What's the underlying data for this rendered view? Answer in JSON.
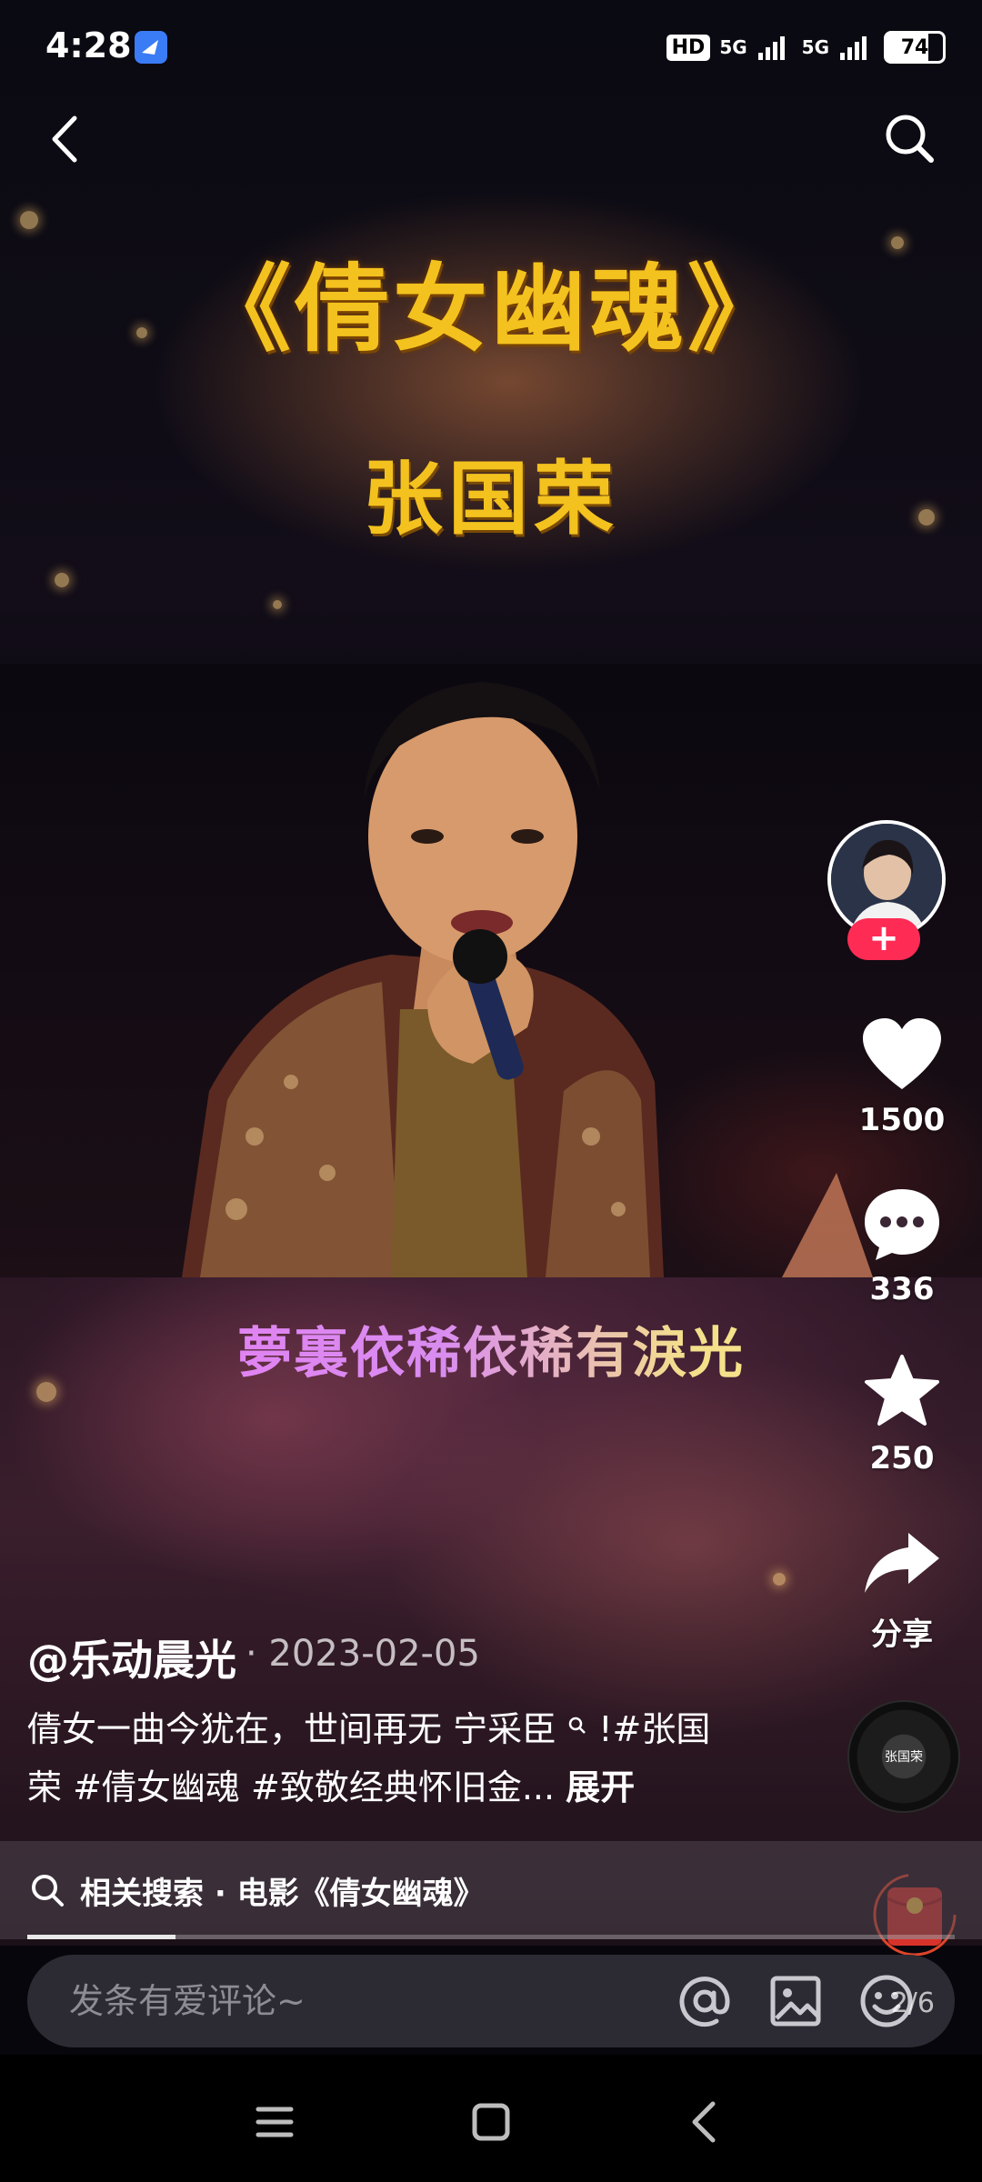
{
  "status_bar": {
    "time": "4:28",
    "network_labels": [
      "HD",
      "5G",
      "5G"
    ],
    "battery": "74"
  },
  "video": {
    "title": "《倩女幽魂》",
    "singer": "张国荣",
    "lyric": "夢裏依稀依稀有淚光"
  },
  "rail": {
    "likes": "1500",
    "comments": "336",
    "favorites": "250",
    "share_label": "分享",
    "follow_plus": "+",
    "disc_text": "张国荣"
  },
  "post": {
    "author": "@乐动晨光",
    "date": "· 2023-02-05",
    "description": "倩女一曲今犹在，世间再无 宁采臣",
    "description_tail": " !#张国荣 #倩女幽魂 #致敬经典怀旧金... ",
    "expand_label": "展开"
  },
  "related_search": {
    "label": "相关搜索 · 电影《倩女幽魂》"
  },
  "progress": 0.16,
  "comment_bar": {
    "placeholder": "发条有爱评论~",
    "page_indicator": "2/6"
  },
  "colors": {
    "accent": "#fe2c55",
    "title_gold": "#f4c21e",
    "feishu_blue": "#3a7bf6"
  },
  "icons": [
    "back-icon",
    "search-icon",
    "heart-icon",
    "comment-icon",
    "star-icon",
    "share-icon",
    "at-icon",
    "image-icon",
    "emoji-icon",
    "menu-icon",
    "home-icon",
    "back-nav-icon"
  ]
}
